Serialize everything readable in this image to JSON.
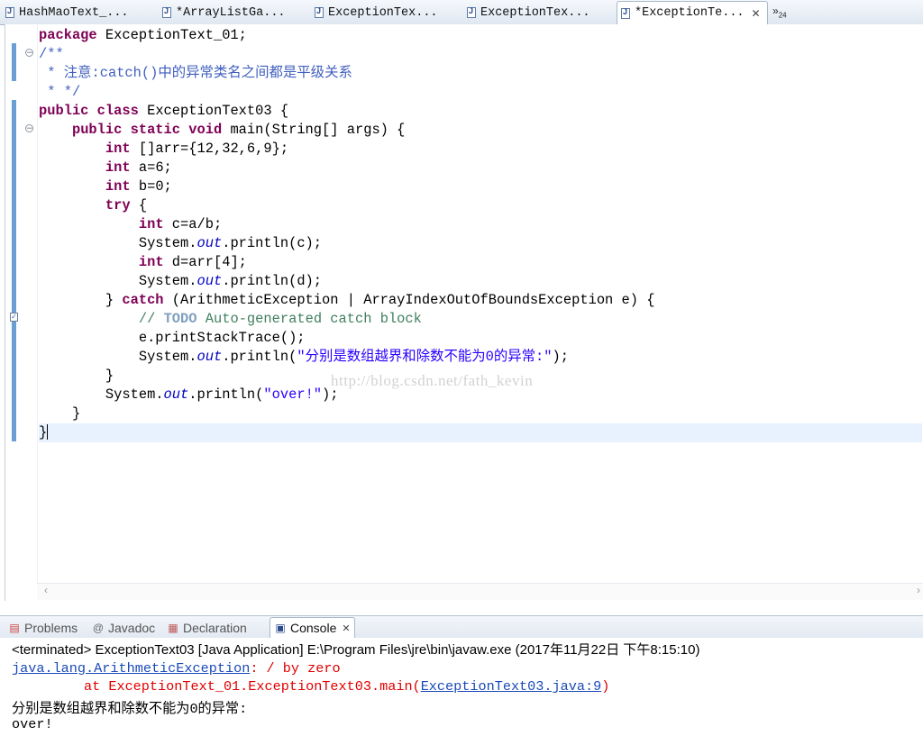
{
  "editor_tabs": [
    {
      "label": "HashMaoText_...",
      "active": false
    },
    {
      "label": "*ArrayListGa...",
      "active": false
    },
    {
      "label": "ExceptionTex...",
      "active": false
    },
    {
      "label": "ExceptionTex...",
      "active": false
    },
    {
      "label": "*ExceptionTe...",
      "active": true
    }
  ],
  "overflow": {
    "glyph": "»",
    "count": "24"
  },
  "code": {
    "l1_kw": "package",
    "l1_rest": " ExceptionText_01;",
    "l2": "/**",
    "l3": " * 注意:catch()中的异常类名之间都是平级关系",
    "l4": " * */",
    "l5_kw": "public class",
    "l5_rest": " ExceptionText03 {",
    "l6_indent": "    ",
    "l6_kw": "public static void",
    "l6_rest": " main(String[] args) {",
    "l7_indent": "        ",
    "l7_kw": "int",
    "l7_rest": " []arr={12,32,6,9};",
    "l8_indent": "        ",
    "l8_kw": "int",
    "l8_rest": " a=6;",
    "l9_indent": "        ",
    "l9_kw": "int",
    "l9_rest": " b=0;",
    "l10_indent": "        ",
    "l10_kw": "try",
    "l10_rest": " {",
    "l11_indent": "            ",
    "l11_kw": "int",
    "l11_rest": " c=a/b;",
    "l12_a": "            System.",
    "l12_field": "out",
    "l12_b": ".println(c);",
    "l13_indent": "            ",
    "l13_kw": "int",
    "l13_rest": " d=arr[4];",
    "l14_a": "            System.",
    "l14_field": "out",
    "l14_b": ".println(d);",
    "l15_a": "        } ",
    "l15_kw": "catch",
    "l15_b": " (ArithmeticException | ArrayIndexOutOfBoundsException e) {",
    "l16_indent": "            ",
    "l16_a": "// ",
    "l16_todo": "TODO",
    "l16_b": " Auto-generated catch block",
    "l17": "            e.printStackTrace();",
    "l18_a": "            System.",
    "l18_field": "out",
    "l18_b": ".println(",
    "l18_str": "\"分别是数组越界和除数不能为0的异常:\"",
    "l18_c": ");",
    "l19": "        }",
    "l20_a": "        System.",
    "l20_field": "out",
    "l20_b": ".println(",
    "l20_str": "\"over!\"",
    "l20_c": ");",
    "l21": "    }",
    "l22": "}"
  },
  "watermark": "http://blog.csdn.net/fath_kevin",
  "panel_tabs": [
    {
      "label": "Problems",
      "icon": "problems-icon",
      "active": false
    },
    {
      "label": "Javadoc",
      "icon": "at-icon",
      "active": false
    },
    {
      "label": "Declaration",
      "icon": "declaration-icon",
      "active": false
    },
    {
      "label": "Console",
      "icon": "console-icon",
      "active": true
    }
  ],
  "console": {
    "status": "<terminated> ExceptionText03 [Java Application] E:\\Program Files\\jre\\bin\\javaw.exe (2017年11月22日 下午8:15:10)",
    "exc_class": "java.lang.ArithmeticException",
    "exc_msg": ": / by zero",
    "at_prefix": "\tat ExceptionText_01.ExceptionText03.main(",
    "at_link": "ExceptionText03.java:9",
    "at_suffix": ")",
    "out1": "分别是数组越界和除数不能为0的异常:",
    "out2": "over!"
  },
  "colors": {
    "keyword": "#7f0055",
    "javadoc": "#3f5fbf",
    "comment": "#3f7f5f",
    "string": "#2a00ff",
    "field": "#0000c0",
    "error": "#e00000",
    "link": "#1a4ab8"
  }
}
